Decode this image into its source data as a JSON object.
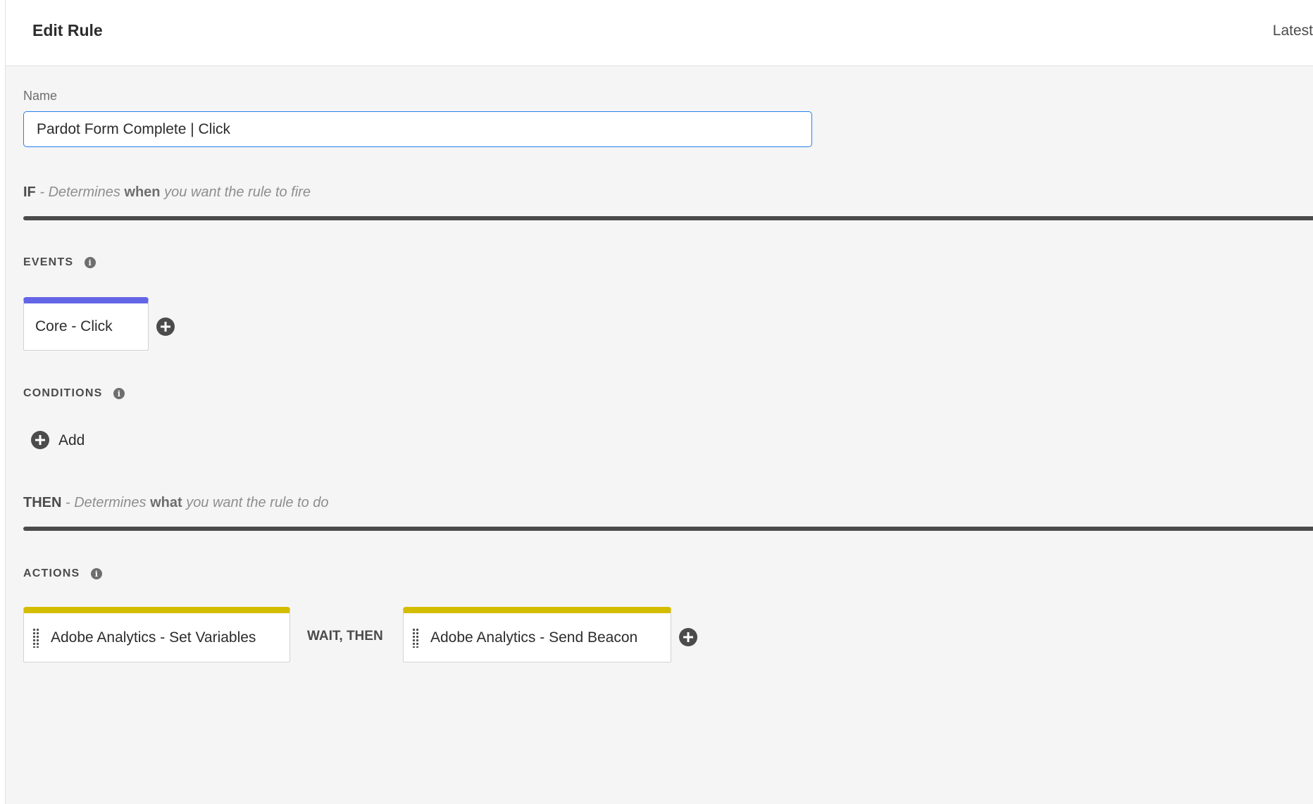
{
  "header": {
    "title": "Edit Rule",
    "right_label": "Latest"
  },
  "name_field": {
    "label": "Name",
    "value": "Pardot Form Complete | Click"
  },
  "if_section": {
    "keyword": "IF",
    "desc_before": "Determines",
    "desc_emphasis": "when",
    "desc_after": "you want the rule to fire"
  },
  "events": {
    "heading": "EVENTS",
    "items": [
      {
        "label": "Core - Click"
      }
    ]
  },
  "conditions": {
    "heading": "CONDITIONS",
    "add_label": "Add"
  },
  "then_section": {
    "keyword": "THEN",
    "desc_before": "Determines",
    "desc_emphasis": "what",
    "desc_after": "you want the rule to do"
  },
  "actions": {
    "heading": "ACTIONS",
    "items": [
      {
        "label": "Adobe Analytics - Set Variables"
      },
      {
        "label": "Adobe Analytics - Send Beacon"
      }
    ],
    "separator": "WAIT, THEN"
  },
  "colors": {
    "event_accent": "#6464e6",
    "action_accent": "#d4bd00",
    "input_focus": "#2680eb"
  }
}
